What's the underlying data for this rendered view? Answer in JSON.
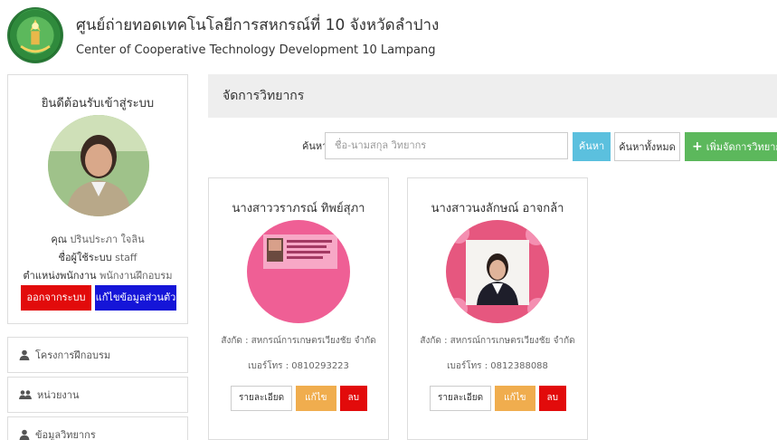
{
  "header": {
    "title_th": "ศูนย์ถ่ายทอดเทคโนโลยีการสหกรณ์ที่ 10 จังหวัดลำปาง",
    "title_en": "Center of Cooperative Technology Development 10 Lampang"
  },
  "profile": {
    "welcome": "ยินดีต้อนรับเข้าสู่ระบบ",
    "name_label": "คุณ",
    "name_value": "ปรินประภา ใจลิน",
    "user_label": "ชื่อผู้ใช้ระบบ",
    "user_value": "staff",
    "position_label": "ตำแหน่งพนักงาน",
    "position_value": "พนักงานฝึกอบรม",
    "logout_label": "ออกจากระบบ",
    "edit_profile_label": "แก้ไขข้อมูลส่วนตัว"
  },
  "sidebar": {
    "items": [
      {
        "label": "โครงการฝึกอบรม",
        "icon": "user-icon"
      },
      {
        "label": "หน่วยงาน",
        "icon": "users-icon"
      },
      {
        "label": "ข้อมูลวิทยากร",
        "icon": "user-icon"
      }
    ]
  },
  "main": {
    "page_title": "จัดการวิทยากร",
    "search_label": "ค้นหา",
    "search_colon": ":",
    "search_placeholder": "ชื่อ-นามสกุล วิทยากร",
    "search_button": "ค้นหา",
    "search_all_button": "ค้นหาทั้งหมด",
    "add_button": "เพิ่มจัดการวิทยากร"
  },
  "cards": [
    {
      "name": "นางสาววราภรณ์ ทิพย์สุภา",
      "affiliation": "สังกัด : สหกรณ์การเกษตรเวียงชัย จำกัด",
      "phone": "เบอร์โทร : 0810293223",
      "detail_label": "รายละเอียด",
      "edit_label": "แก้ไข",
      "delete_label": "ลบ"
    },
    {
      "name": "นางสาวนงลักษณ์ อาจกล้า",
      "affiliation": "สังกัด : สหกรณ์การเกษตรเวียงชัย จำกัด",
      "phone": "เบอร์โทร : 0812388088",
      "detail_label": "รายละเอียด",
      "edit_label": "แก้ไข",
      "delete_label": "ลบ"
    }
  ],
  "colors": {
    "danger": "#e20b0b",
    "primary": "#1515d8",
    "info": "#5bc0de",
    "success": "#5cb85c",
    "warning": "#f0ad4e"
  }
}
